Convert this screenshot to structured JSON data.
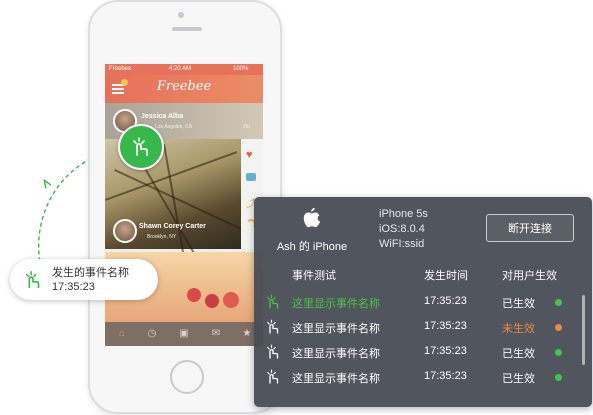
{
  "phone": {
    "status_carrier": "Freebee",
    "status_time": "4:20 AM",
    "status_battery": "100%",
    "app_title": "Freebee",
    "cards": [
      {
        "name": "Jessica Alba",
        "location": "Los Angeles, CA",
        "age": "2m"
      },
      {
        "name": "Shawn Corey Carter",
        "location": "Brooklyn, NY"
      }
    ],
    "tabs": [
      "home-icon",
      "clock-icon",
      "camera-icon",
      "mail-icon",
      "star-icon"
    ]
  },
  "event_bubble": {
    "name": "发生的事件名称",
    "time": "17:35:23"
  },
  "panel": {
    "device_name": "Ash 的 iPhone",
    "model": "iPhone 5s",
    "ios": "iOS:8.0.4",
    "wifi": "WiFI:ssid",
    "disconnect_label": "断开连接",
    "headers": {
      "event": "事件测试",
      "time": "发生时间",
      "effect": "对用户生效"
    },
    "rows": [
      {
        "name": "这里显示事件名称",
        "time": "17:35:23",
        "status": "已生效",
        "name_color": "#4fc14a",
        "status_color": "#ffffff",
        "dot": "#3cc84a"
      },
      {
        "name": "这里显示事件名称",
        "time": "17:35:23",
        "status": "未生效",
        "name_color": "#ffffff",
        "status_color": "#f08a3c",
        "dot": "#f08a3c"
      },
      {
        "name": "这里显示事件名称",
        "time": "17:35:23",
        "status": "已生效",
        "name_color": "#ffffff",
        "status_color": "#ffffff",
        "dot": "#3cc84a"
      },
      {
        "name": "这里显示事件名称",
        "time": "17:35:23",
        "status": "已生效",
        "name_color": "#ffffff",
        "status_color": "#ffffff",
        "dot": "#3cc84a"
      }
    ]
  },
  "colors": {
    "accent_green": "#36b94a",
    "app_bar": "#e5705a",
    "panel_bg": "#484c54"
  }
}
